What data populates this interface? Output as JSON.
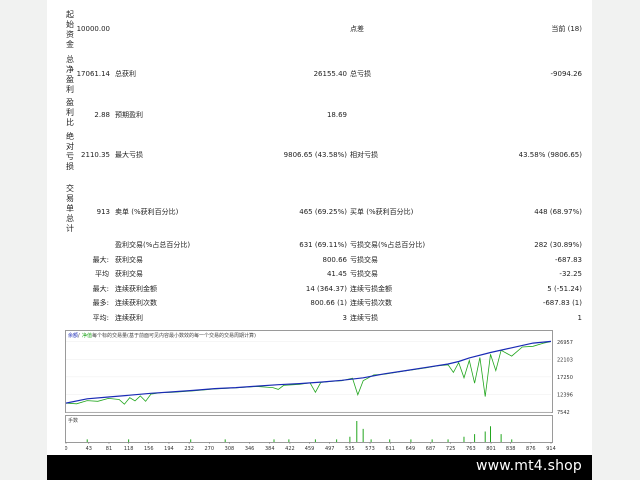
{
  "report": {
    "sections": [
      {
        "label": "起始资金",
        "value": "10000.00"
      },
      {
        "label": "总净盈利",
        "value": "17061.14"
      },
      {
        "label": "盈利比",
        "value": "2.88"
      },
      {
        "label": "绝对亏损",
        "value": "2110.35"
      },
      {
        "label": "交易单总计",
        "value": "913"
      }
    ],
    "row1": {
      "mid_label": "点差",
      "right_label": "当前 (18)"
    },
    "row2": {
      "label_a": "总获利",
      "value_a": "26155.40",
      "label_b": "总亏损",
      "value_b": "-9094.26"
    },
    "row3": {
      "label_a": "预期盈利",
      "value_a": "18.69"
    },
    "row4": {
      "label_a": "最大亏损",
      "value_a": "9806.65 (43.58%)",
      "label_b": "相对亏损",
      "value_b": "43.58% (9806.65)"
    },
    "row5": {
      "label_a": "卖单 (%获利百分比)",
      "value_a": "465 (69.25%)",
      "label_b": "买单 (%获利百分比)",
      "value_b": "448 (68.97%)"
    },
    "row6": {
      "label_a": "盈利交易(%占总百分比)",
      "value_a": "631 (69.11%)",
      "label_b": "亏损交易(%占总百分比)",
      "value_b": "282 (30.89%)"
    },
    "row7": {
      "prefix": "最大:",
      "label_a": "获利交易",
      "value_a": "800.66",
      "label_b": "亏损交易",
      "value_b": "-687.83"
    },
    "row8": {
      "prefix": "平均",
      "label_a": "获利交易",
      "value_a": "41.45",
      "label_b": "亏损交易",
      "value_b": "-32.25"
    },
    "row9": {
      "prefix": "最大:",
      "label_a": "连续获利金额",
      "value_a": "14 (364.37)",
      "label_b": "连续亏损金额",
      "value_b": "5 (-51.24)"
    },
    "row10": {
      "prefix": "最多:",
      "label_a": "连续获利次数",
      "value_a": "800.66 (1)",
      "label_b": "连续亏损次数",
      "value_b": "-687.83 (1)"
    },
    "row11": {
      "prefix": "平均:",
      "label_a": "连续获利",
      "value_a": "3",
      "label_b": "连续亏损",
      "value_b": "1"
    }
  },
  "chart_header": {
    "legend_balance": "余额",
    "legend_equity": "净值",
    "caption": "每个标的交易量(基于前面可见内容最小数效的每一个交易的交易周期计算)"
  },
  "volume_label": "手数",
  "footer": {
    "brand": "www.mt4.shop"
  },
  "colors": {
    "balance": "#1a2ab5",
    "equity": "#22a61e",
    "volume": "#22a61e"
  },
  "chart_data": {
    "type": "line",
    "x_ticks": [
      0,
      43,
      81,
      118,
      156,
      194,
      232,
      270,
      308,
      346,
      384,
      422,
      459,
      497,
      535,
      573,
      611,
      649,
      687,
      725,
      763,
      801,
      838,
      876,
      914
    ],
    "y_ticks": [
      7542,
      12396,
      17250,
      22103,
      26957
    ],
    "ylim": [
      7542,
      28000
    ],
    "xlim": [
      0,
      914
    ],
    "series": [
      {
        "name": "余额",
        "x": [
          0,
          40,
          80,
          120,
          160,
          200,
          240,
          280,
          320,
          360,
          400,
          440,
          480,
          520,
          560,
          600,
          640,
          680,
          720,
          740,
          760,
          800,
          840,
          880,
          914
        ],
        "y": [
          10000,
          11200,
          11700,
          12200,
          12700,
          13100,
          13500,
          14000,
          14300,
          14700,
          15100,
          15400,
          15800,
          16300,
          17000,
          18100,
          19000,
          19900,
          20800,
          21500,
          22500,
          24000,
          25300,
          26600,
          27061
        ]
      },
      {
        "name": "净值",
        "x": [
          0,
          20,
          40,
          60,
          80,
          100,
          110,
          120,
          130,
          140,
          150,
          160,
          180,
          200,
          240,
          280,
          320,
          360,
          390,
          400,
          410,
          440,
          460,
          470,
          480,
          500,
          520,
          540,
          550,
          560,
          570,
          580,
          600,
          640,
          680,
          700,
          720,
          730,
          740,
          750,
          760,
          770,
          780,
          790,
          800,
          810,
          820,
          840,
          860,
          880,
          900,
          914
        ],
        "y": [
          10000,
          9800,
          10700,
          10500,
          11300,
          11000,
          9700,
          11500,
          10600,
          12000,
          10500,
          12500,
          12900,
          13000,
          13400,
          13900,
          14200,
          14600,
          14300,
          13800,
          14900,
          15200,
          15600,
          13000,
          15700,
          16000,
          16200,
          16900,
          12300,
          16200,
          17000,
          17800,
          18000,
          18900,
          19800,
          20300,
          20600,
          18500,
          21200,
          17000,
          21800,
          15500,
          22600,
          11800,
          23500,
          19000,
          24600,
          23000,
          25500,
          25700,
          26600,
          27000
        ]
      }
    ],
    "volume": {
      "x": [
        40,
        118,
        235,
        300,
        392,
        420,
        470,
        510,
        535,
        548,
        560,
        575,
        610,
        650,
        690,
        720,
        750,
        770,
        790,
        800,
        820,
        840
      ],
      "values": [
        1,
        1,
        1,
        1,
        1,
        1,
        1,
        1,
        2,
        8,
        5,
        1,
        1,
        1,
        1,
        1,
        2,
        3,
        4,
        6,
        3,
        1
      ]
    }
  }
}
